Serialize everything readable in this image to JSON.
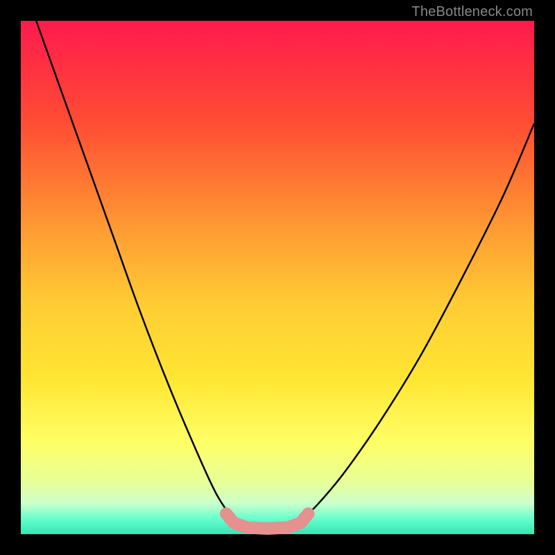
{
  "watermark": {
    "text": "TheBottleneck.com"
  },
  "chart_data": {
    "type": "line",
    "title": "",
    "xlabel": "",
    "ylabel": "",
    "xlim": [
      0,
      100
    ],
    "ylim": [
      0,
      100
    ],
    "series": [
      {
        "name": "left-curve",
        "x": [
          3,
          8,
          13,
          18,
          23,
          28,
          33,
          38,
          42
        ],
        "y": [
          100,
          86,
          72,
          58,
          44,
          31,
          19,
          8,
          2
        ]
      },
      {
        "name": "right-curve",
        "x": [
          54,
          58,
          63,
          70,
          78,
          86,
          94,
          100
        ],
        "y": [
          2,
          6,
          12,
          22,
          35,
          50,
          66,
          80
        ]
      },
      {
        "name": "trough-marker",
        "type": "scatter",
        "x": [
          40,
          41.5,
          44,
          48,
          52,
          54.5,
          56
        ],
        "y": [
          4,
          2.2,
          1.3,
          1.1,
          1.3,
          2.2,
          4
        ]
      }
    ],
    "annotations": [],
    "colors": {
      "curve": "#000000",
      "marker": "#e69090",
      "gradient_top": "#ff1a4d",
      "gradient_bottom": "#33e6b3"
    }
  }
}
